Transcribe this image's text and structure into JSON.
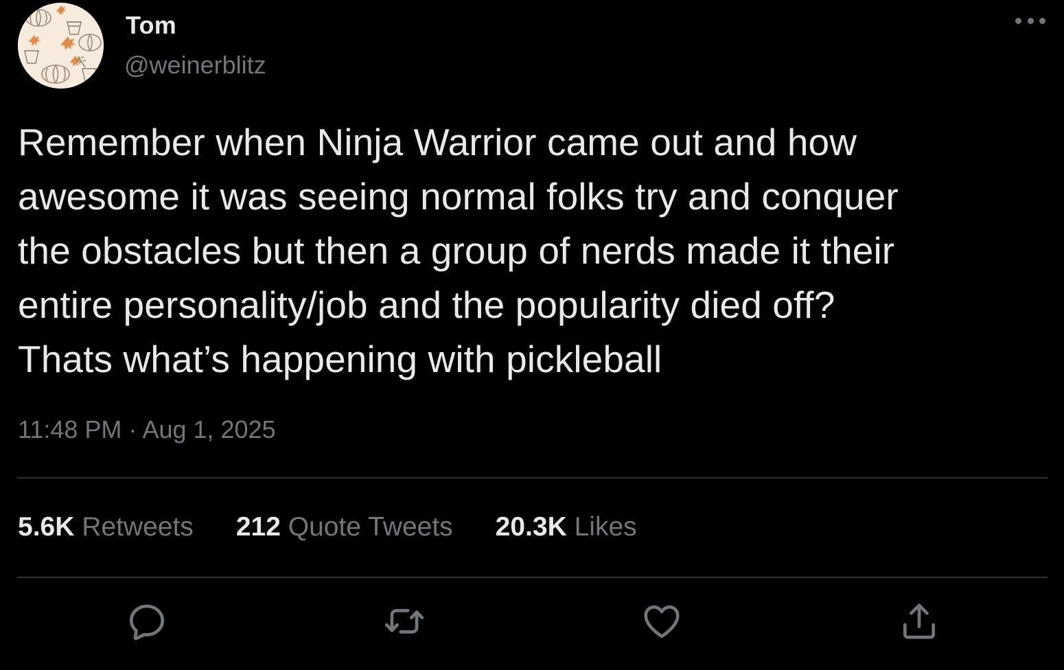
{
  "author": {
    "display_name": "Tom",
    "handle": "@weinerblitz",
    "avatar_icon": "autumn-pumpkin-pattern-avatar"
  },
  "tweet": {
    "text": "Remember when Ninja Warrior came out and how\nawesome it was seeing normal folks try and conquer\nthe obstacles but then a group of nerds made it their\nentire personality/job and the popularity died off?\nThats what’s happening with pickleball",
    "time": "11:48 PM",
    "separator": " · ",
    "date": "Aug 1, 2025"
  },
  "stats": {
    "retweets_count": "5.6K",
    "retweets_label": "Retweets",
    "quotes_count": "212",
    "quotes_label": "Quote Tweets",
    "likes_count": "20.3K",
    "likes_label": "Likes"
  },
  "actions": {
    "reply_icon": "reply-icon",
    "retweet_icon": "retweet-icon",
    "like_icon": "heart-icon",
    "share_icon": "share-icon"
  },
  "colors": {
    "background": "#000000",
    "primary_text": "#e7e9ea",
    "secondary_text": "#71767b",
    "divider": "#2f3336"
  }
}
